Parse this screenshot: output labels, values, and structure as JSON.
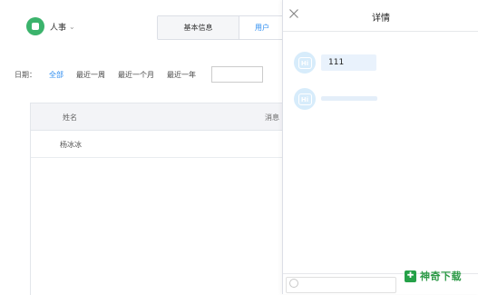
{
  "app": {
    "department": "人事",
    "tabs": [
      {
        "label": "基本信息"
      },
      {
        "label": "用户"
      }
    ]
  },
  "filter": {
    "label": "日期：",
    "options": [
      "全部",
      "最近一周",
      "最近一个月",
      "最近一年"
    ],
    "selected": "全部",
    "date_value": ""
  },
  "table": {
    "headers": [
      "姓名",
      "消息"
    ],
    "rows": [
      {
        "name": "杨冰冰"
      }
    ]
  },
  "panel": {
    "title": "详情",
    "messages": [
      {
        "avatar": "Hi",
        "text": "111"
      },
      {
        "avatar": "Hi",
        "text": ""
      }
    ],
    "input_placeholder": ""
  },
  "watermark": {
    "text": "神奇下载"
  },
  "colors": {
    "accent": "#2d8cf0",
    "brand": "#3bb36c",
    "bubble": "#e9f2fc"
  }
}
